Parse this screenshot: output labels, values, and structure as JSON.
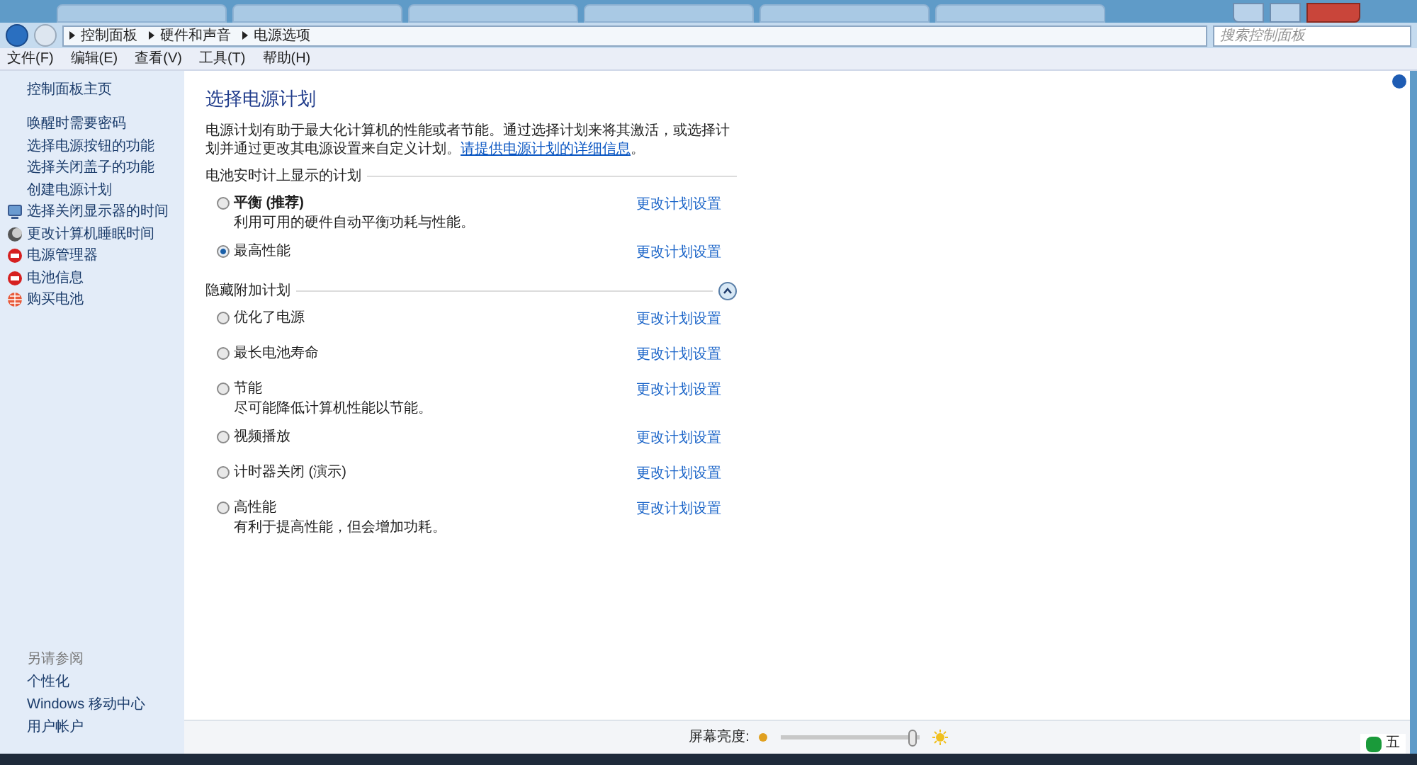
{
  "address_bar": {
    "path": [
      "控制面板",
      "硬件和声音",
      "电源选项"
    ],
    "search_placeholder": "搜索控制面板"
  },
  "menu": [
    "文件(F)",
    "编辑(E)",
    "查看(V)",
    "工具(T)",
    "帮助(H)"
  ],
  "sidebar": {
    "home": "控制面板主页",
    "links": [
      {
        "label": "唤醒时需要密码",
        "kind": "text"
      },
      {
        "label": "选择电源按钮的功能",
        "kind": "text"
      },
      {
        "label": "选择关闭盖子的功能",
        "kind": "text"
      },
      {
        "label": "创建电源计划",
        "kind": "text"
      },
      {
        "label": "选择关闭显示器的时间",
        "kind": "monitor"
      },
      {
        "label": "更改计算机睡眠时间",
        "kind": "moon"
      },
      {
        "label": "电源管理器",
        "kind": "red"
      },
      {
        "label": "电池信息",
        "kind": "red"
      },
      {
        "label": "购买电池",
        "kind": "globe"
      }
    ],
    "see_also_title": "另请参阅",
    "see_also": [
      "个性化",
      "Windows 移动中心",
      "用户帐户"
    ]
  },
  "content": {
    "title": "选择电源计划",
    "intro": "电源计划有助于最大化计算机的性能或者节能。通过选择计划来将其激活，或选择计划并通过更改其电源设置来自定义计划。",
    "intro_link": "请提供电源计划的详细信息",
    "intro_end": "。",
    "groups": [
      {
        "title": "电池安时计上显示的计划",
        "plans": [
          {
            "name": "平衡 (推荐)",
            "bold": true,
            "description": "利用可用的硬件自动平衡功耗与性能。",
            "selected": false,
            "link": "更改计划设置"
          },
          {
            "name": "最高性能",
            "bold": false,
            "selected": true,
            "link": "更改计划设置"
          }
        ]
      },
      {
        "title": "隐藏附加计划",
        "expanded": true,
        "plans": [
          {
            "name": "优化了电源",
            "bold": false,
            "selected": false,
            "link": "更改计划设置"
          },
          {
            "name": "最长电池寿命",
            "bold": false,
            "selected": false,
            "link": "更改计划设置"
          },
          {
            "name": "节能",
            "bold": false,
            "description": "尽可能降低计算机性能以节能。",
            "selected": false,
            "link": "更改计划设置"
          },
          {
            "name": "视频播放",
            "bold": false,
            "selected": false,
            "link": "更改计划设置"
          },
          {
            "name": "计时器关闭 (演示)",
            "bold": false,
            "selected": false,
            "link": "更改计划设置"
          },
          {
            "name": "高性能",
            "bold": false,
            "description": "有利于提高性能，但会增加功耗。",
            "selected": false,
            "link": "更改计划设置"
          }
        ]
      }
    ]
  },
  "brightness": {
    "label": "屏幕亮度:",
    "level": 0.95
  },
  "tray": [
    "五"
  ]
}
